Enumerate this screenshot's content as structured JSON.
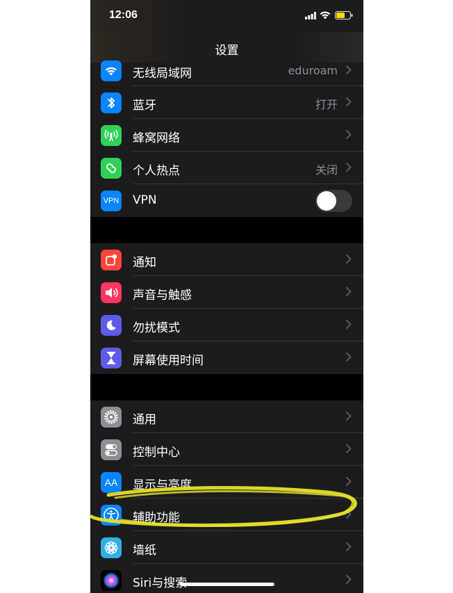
{
  "status_bar": {
    "time": "12:06"
  },
  "nav": {
    "title": "设置"
  },
  "group1": [
    {
      "label": "无线局域网",
      "value": "eduroam",
      "icon": "wifi-icon",
      "color": "#0a84ff"
    },
    {
      "label": "蓝牙",
      "value": "打开",
      "icon": "bluetooth-icon",
      "color": "#0a84ff"
    },
    {
      "label": "蜂窝网络",
      "value": "",
      "icon": "cellular-icon",
      "color": "#30d158"
    },
    {
      "label": "个人热点",
      "value": "关闭",
      "icon": "hotspot-icon",
      "color": "#30d158"
    },
    {
      "label": "VPN",
      "icon": "vpn-icon",
      "icon_text": "VPN",
      "color": "#0a84ff",
      "toggle": "off"
    }
  ],
  "group2": [
    {
      "label": "通知",
      "icon": "notifications-icon",
      "color": "#ff453a"
    },
    {
      "label": "声音与触感",
      "icon": "sound-icon",
      "color": "#ff375f"
    },
    {
      "label": "勿扰模式",
      "icon": "moon-icon",
      "color": "#5e5ce6"
    },
    {
      "label": "屏幕使用时间",
      "icon": "hourglass-icon",
      "color": "#5e5ce6"
    }
  ],
  "group3": [
    {
      "label": "通用",
      "icon": "gear-icon",
      "color": "#8e8e93"
    },
    {
      "label": "控制中心",
      "icon": "control-center-icon",
      "color": "#8e8e93"
    },
    {
      "label": "显示与亮度",
      "icon": "display-icon",
      "icon_text": "AA",
      "color": "#0a84ff"
    },
    {
      "label": "辅助功能",
      "icon": "accessibility-icon",
      "color": "#0a84ff"
    },
    {
      "label": "墙纸",
      "icon": "wallpaper-icon",
      "color": "#32ade6"
    },
    {
      "label": "Siri与搜索",
      "icon": "siri-icon",
      "color": "#1c1c1e"
    }
  ],
  "annotation": {
    "highlighted_item": "辅助功能",
    "highlight_color": "#e6e12a"
  }
}
